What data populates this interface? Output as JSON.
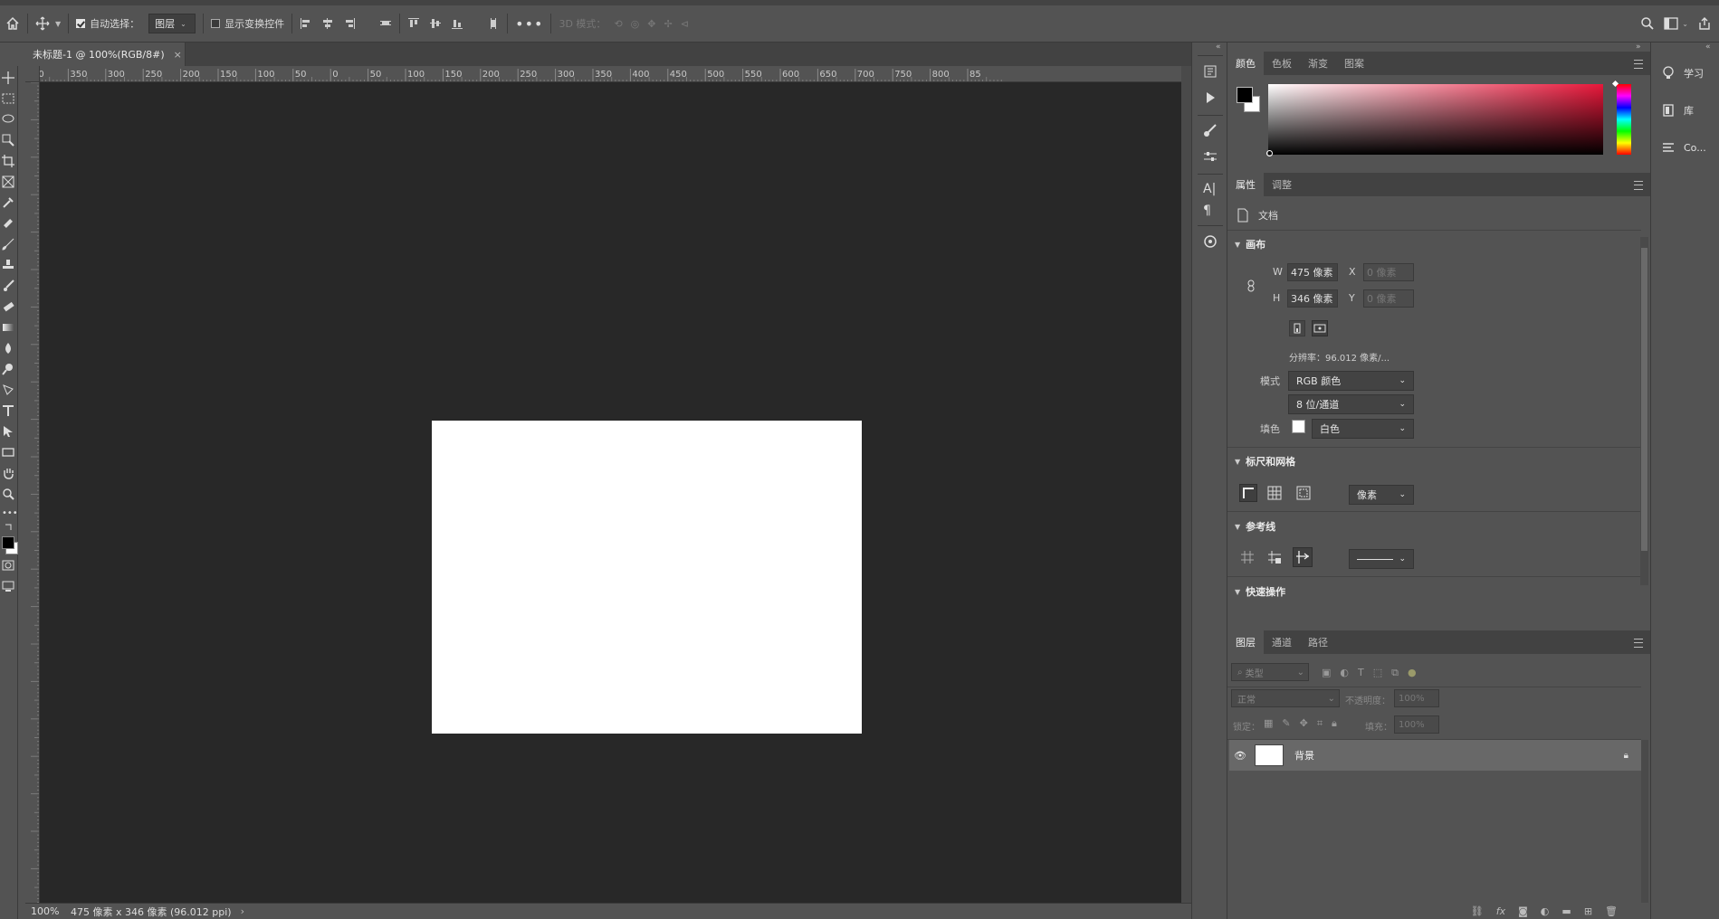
{
  "options_bar": {
    "auto_select_label": "自动选择：",
    "auto_select_target": "图层",
    "show_transform_label": "显示变换控件",
    "mode_3d_label": "3D 模式："
  },
  "document": {
    "tab_title": "未标题-1 @ 100%(RGB/8#)",
    "zoom": "100%",
    "status_info": "475 像素 x 346 像素 (96.012 ppi)"
  },
  "rulers": {
    "h_ticks": [
      "00",
      "350",
      "300",
      "250",
      "200",
      "150",
      "100",
      "50",
      "0",
      "50",
      "100",
      "150",
      "200",
      "250",
      "300",
      "350",
      "400",
      "450",
      "500",
      "550",
      "600",
      "650",
      "700",
      "750",
      "800",
      "85"
    ]
  },
  "color_panel": {
    "tabs": [
      "颜色",
      "色板",
      "渐变",
      "图案"
    ],
    "foreground": "#000000",
    "background": "#ffffff",
    "hue": "#e8173a"
  },
  "properties_panel": {
    "tabs": [
      "属性",
      "调整"
    ],
    "doc_label": "文档",
    "canvas_section": "画布",
    "w_label": "W",
    "h_label": "H",
    "x_label": "X",
    "y_label": "Y",
    "width": "475 像素",
    "height": "346 像素",
    "x_value": "0 像素",
    "y_value": "0 像素",
    "resolution": "分辨率：96.012 像素/...",
    "mode_label": "模式",
    "mode_value": "RGB 颜色",
    "depth_value": "8 位/通道",
    "fill_label": "填色",
    "fill_value": "白色",
    "rulers_section": "标尺和网格",
    "units_value": "像素",
    "guides_section": "参考线",
    "quick_section": "快速操作"
  },
  "layers_panel": {
    "tabs": [
      "图层",
      "通道",
      "路径"
    ],
    "filter_placeholder": "类型",
    "blend_mode": "正常",
    "opacity_label": "不透明度：",
    "opacity_value": "100%",
    "lock_label": "锁定：",
    "fill_label": "填充：",
    "fill_value": "100%",
    "layers": [
      {
        "name": "背景",
        "visible": true,
        "locked": true
      }
    ]
  },
  "far_right": {
    "items": [
      "学习",
      "库",
      "Co..."
    ]
  }
}
